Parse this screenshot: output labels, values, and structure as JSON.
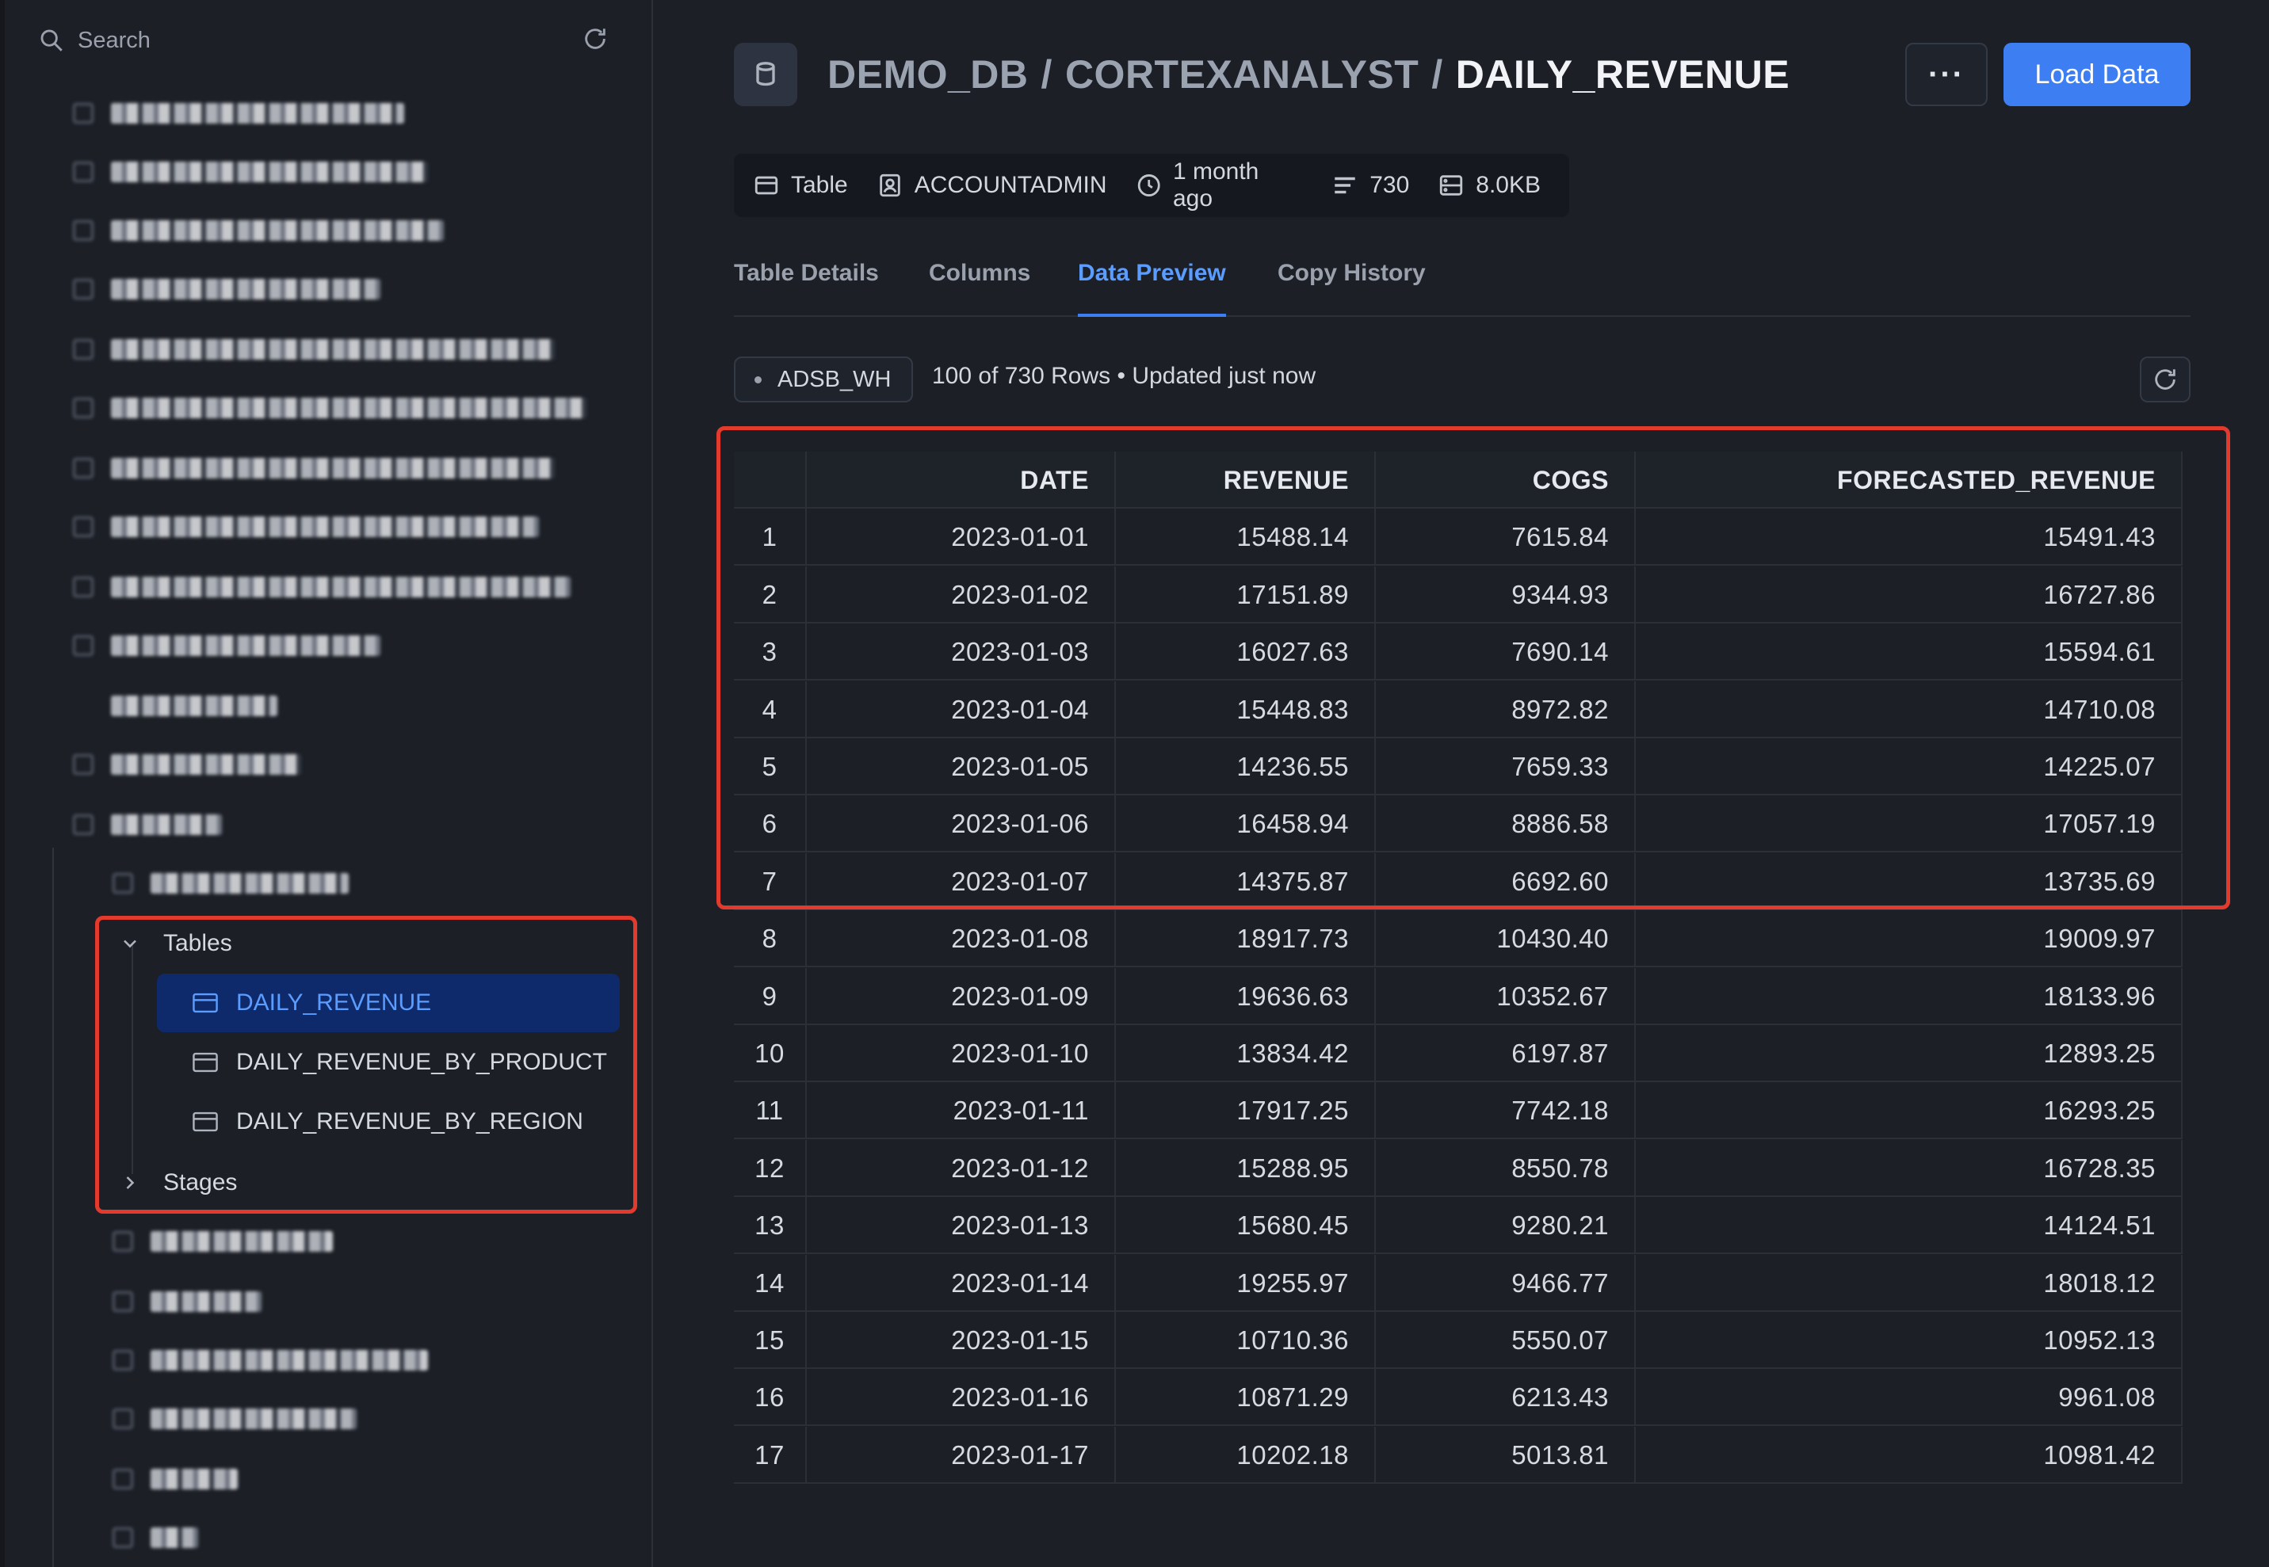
{
  "sidebar": {
    "search_placeholder": "Search",
    "tables_group_label": "Tables",
    "stages_group_label": "Stages",
    "tables": [
      {
        "label": "DAILY_REVENUE",
        "active": true
      },
      {
        "label": "DAILY_REVENUE_BY_PRODUCT",
        "active": false
      },
      {
        "label": "DAILY_REVENUE_BY_REGION",
        "active": false
      }
    ]
  },
  "header": {
    "breadcrumb": {
      "database": "DEMO_DB",
      "schema": "CORTEXANALYST",
      "object": "DAILY_REVENUE",
      "separator": "/"
    },
    "more_button": "···",
    "load_button": "Load Data"
  },
  "meta": {
    "type": "Table",
    "owner": "ACCOUNTADMIN",
    "created": "1 month ago",
    "row_count": "730",
    "size": "8.0KB"
  },
  "tabs": [
    {
      "label": "Table Details",
      "active": false
    },
    {
      "label": "Columns",
      "active": false
    },
    {
      "label": "Data Preview",
      "active": true
    },
    {
      "label": "Copy History",
      "active": false
    }
  ],
  "preview": {
    "warehouse": "ADSB_WH",
    "rows_info": "100 of 730 Rows • Updated just now",
    "columns": [
      "DATE",
      "REVENUE",
      "COGS",
      "FORECASTED_REVENUE"
    ],
    "rows": [
      [
        "1",
        "2023-01-01",
        "15488.14",
        "7615.84",
        "15491.43"
      ],
      [
        "2",
        "2023-01-02",
        "17151.89",
        "9344.93",
        "16727.86"
      ],
      [
        "3",
        "2023-01-03",
        "16027.63",
        "7690.14",
        "15594.61"
      ],
      [
        "4",
        "2023-01-04",
        "15448.83",
        "8972.82",
        "14710.08"
      ],
      [
        "5",
        "2023-01-05",
        "14236.55",
        "7659.33",
        "14225.07"
      ],
      [
        "6",
        "2023-01-06",
        "16458.94",
        "8886.58",
        "17057.19"
      ],
      [
        "7",
        "2023-01-07",
        "14375.87",
        "6692.60",
        "13735.69"
      ],
      [
        "8",
        "2023-01-08",
        "18917.73",
        "10430.40",
        "19009.97"
      ],
      [
        "9",
        "2023-01-09",
        "19636.63",
        "10352.67",
        "18133.96"
      ],
      [
        "10",
        "2023-01-10",
        "13834.42",
        "6197.87",
        "12893.25"
      ],
      [
        "11",
        "2023-01-11",
        "17917.25",
        "7742.18",
        "16293.25"
      ],
      [
        "12",
        "2023-01-12",
        "15288.95",
        "8550.78",
        "16728.35"
      ],
      [
        "13",
        "2023-01-13",
        "15680.45",
        "9280.21",
        "14124.51"
      ],
      [
        "14",
        "2023-01-14",
        "19255.97",
        "9466.77",
        "18018.12"
      ],
      [
        "15",
        "2023-01-15",
        "10710.36",
        "5550.07",
        "10952.13"
      ],
      [
        "16",
        "2023-01-16",
        "10871.29",
        "6213.43",
        "9961.08"
      ],
      [
        "17",
        "2023-01-17",
        "10202.18",
        "5013.81",
        "10981.42"
      ]
    ]
  },
  "colors": {
    "accent": "#3d7ff2",
    "active_text": "#5b9cff",
    "highlight": "#e23b2e",
    "background": "#1c1f26"
  }
}
